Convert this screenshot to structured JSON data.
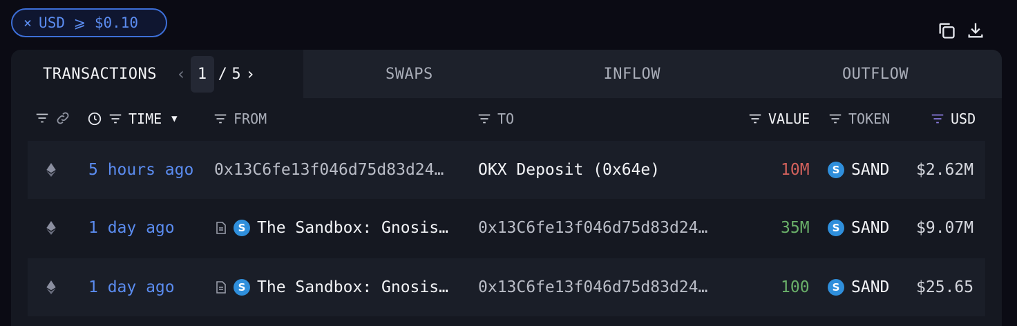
{
  "filter": {
    "label": "USD ⩾ $0.10",
    "close": "×"
  },
  "tabs": {
    "transactions": "TRANSACTIONS",
    "pager_current": "1",
    "pager_sep": "/",
    "pager_total": "5",
    "swaps": "SWAPS",
    "inflow": "INFLOW",
    "outflow": "OUTFLOW"
  },
  "columns": {
    "time": "TIME",
    "from": "FROM",
    "to": "TO",
    "value": "VALUE",
    "token": "TOKEN",
    "usd": "USD"
  },
  "rows": [
    {
      "time": "5 hours ago",
      "from": "0x13C6fe13f046d75d83d24…",
      "to": "OKX Deposit (0x64e)",
      "value": "10M",
      "token": "SAND",
      "usd": "$2.62M"
    },
    {
      "time": "1 day ago",
      "from": "The Sandbox: Gnosis…",
      "to": "0x13C6fe13f046d75d83d24…",
      "value": "35M",
      "token": "SAND",
      "usd": "$9.07M"
    },
    {
      "time": "1 day ago",
      "from": "The Sandbox: Gnosis…",
      "to": "0x13C6fe13f046d75d83d24…",
      "value": "100",
      "token": "SAND",
      "usd": "$25.65"
    }
  ],
  "icons": {
    "token_glyph": "S"
  },
  "colors": {
    "accent": "#5b8cf0",
    "outflow_value": "#d2615c",
    "inflow_value": "#6ab069"
  }
}
